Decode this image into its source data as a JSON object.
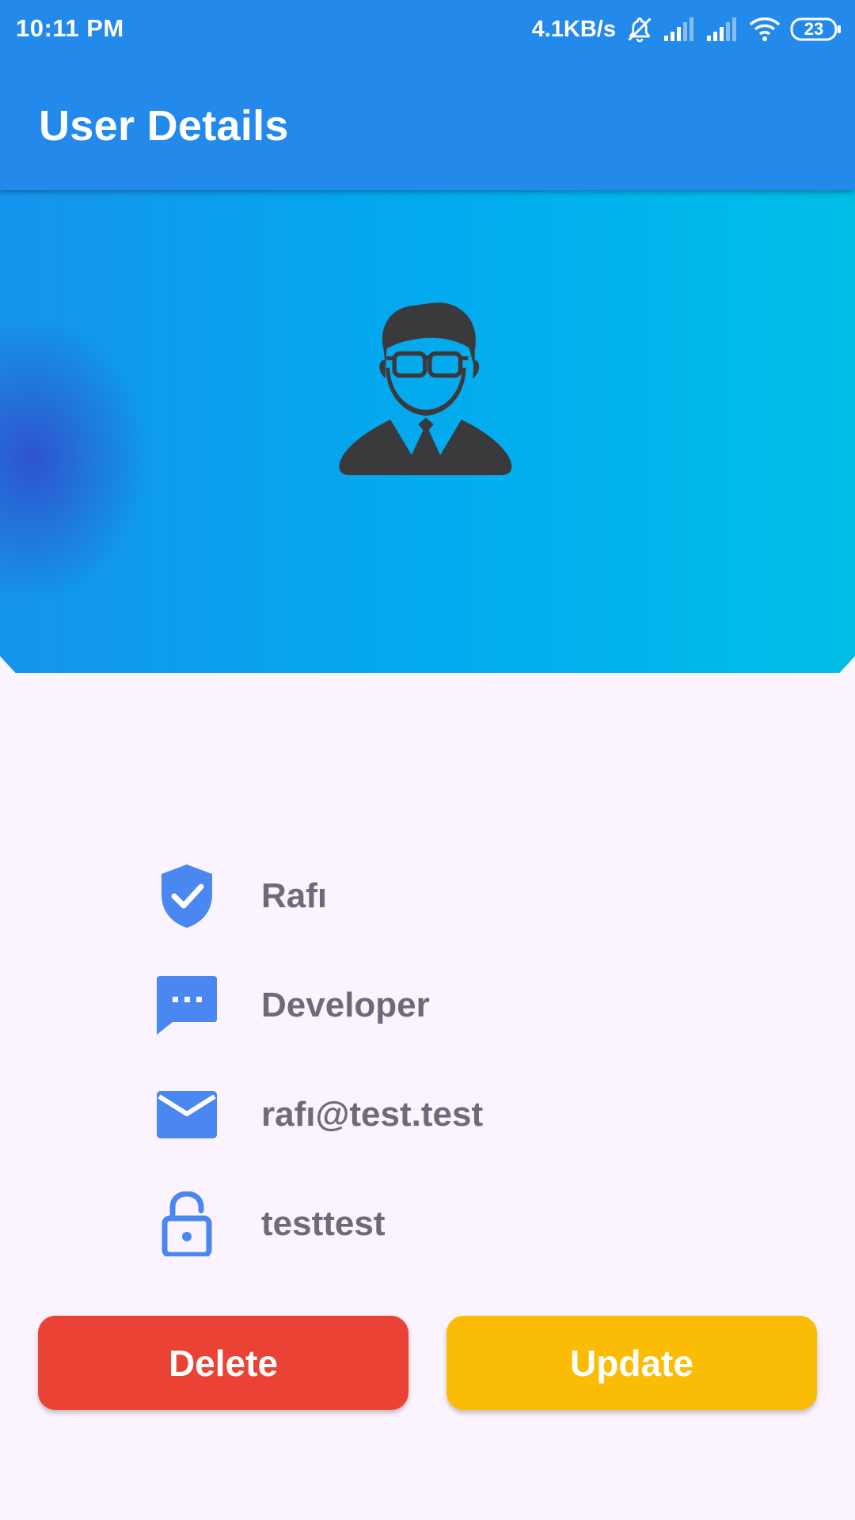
{
  "status_bar": {
    "time": "10:11 PM",
    "net_speed": "4.1KB/s",
    "battery": "23",
    "icons": [
      "bell-muted-icon",
      "signal-icon",
      "signal-icon",
      "wifi-icon",
      "battery-icon"
    ]
  },
  "app_bar": {
    "title": "User Details"
  },
  "header": {
    "avatar_icon": "user-avatar-icon",
    "gradient": [
      "#1f88ea",
      "#04a7ee",
      "#00baec",
      "#00c3d4"
    ]
  },
  "details": {
    "name": "Rafı",
    "role": "Developer",
    "email": "rafı@test.test",
    "password": "testtest",
    "icons": [
      "verified-shield-icon",
      "chat-bubble-icon",
      "mail-icon",
      "lock-open-icon"
    ]
  },
  "actions": {
    "delete_label": "Delete",
    "update_label": "Update"
  },
  "colors": {
    "primary": "#2389ea",
    "icon_accent": "#4a87f0",
    "text": "#6f6a73",
    "delete": "#ea4335",
    "update": "#fbbc05",
    "background": "#fbf3fd"
  }
}
